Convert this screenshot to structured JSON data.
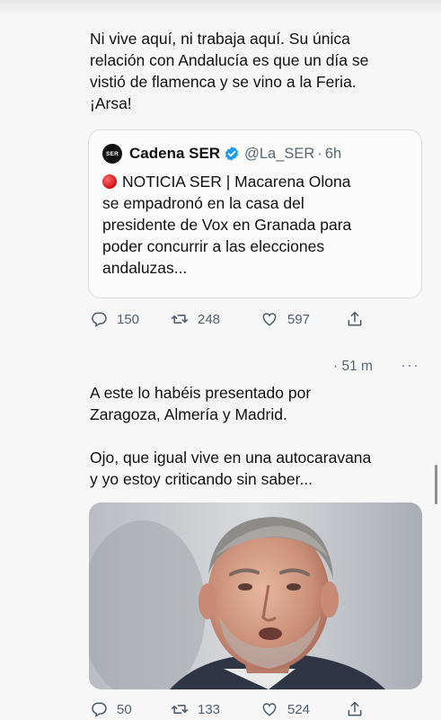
{
  "tweet1": {
    "lines": [
      "Ni vive aquí, ni trabaja aquí. Su única",
      "relación con Andalucía es que un día se",
      "vistió de flamenca y se vino a la Feria.",
      "¡Arsa!"
    ]
  },
  "quote": {
    "avatar_text": "SER",
    "name": "Cadena SER",
    "handle": "@La_SER",
    "separator": "·",
    "time": "6h",
    "icon": "red-circle-emoji",
    "lines": [
      "NOTICIA SER | Macarena Olona",
      "se empadronó en la casa del",
      "presidente de Vox en Granada para",
      "poder concurrir a las elecciones",
      "andaluzas..."
    ]
  },
  "actions1": {
    "replies": "150",
    "retweets": "248",
    "likes": "597"
  },
  "tweet2": {
    "time": "· 51 m",
    "more": "···",
    "paragraph1": [
      "A este lo habéis presentado por",
      "Zaragoza, Almería y Madrid."
    ],
    "paragraph2": [
      "Ojo, que igual vive en una autocaravana",
      "y yo estoy criticando sin saber..."
    ],
    "image": "photo-of-grey-haired-man"
  },
  "actions2": {
    "replies": "50",
    "retweets": "133",
    "likes": "524"
  },
  "colors": {
    "text": "#111111",
    "muted": "#5b6670",
    "verified": "#1d9bf0",
    "alert": "#d40d12"
  }
}
